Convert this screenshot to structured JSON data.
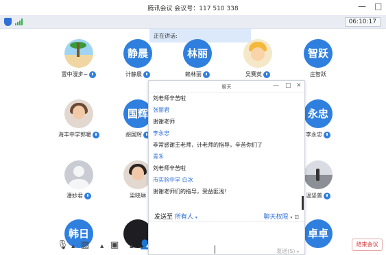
{
  "window": {
    "title": "腾讯会议 会议号：117 510 338",
    "minimize_glyph": "—",
    "maximize_glyph": "□"
  },
  "toolbar": {
    "elapsed": "06:10:17",
    "signal_color": "#38b048",
    "shield_color": "#2f6fd6"
  },
  "speaking": {
    "label": "正在讲话:"
  },
  "participants": {
    "row1": [
      {
        "name": "雲中漫步~",
        "avatar": "beach",
        "mic": true
      },
      {
        "name": "计静晨",
        "avatar_text": "静晨",
        "mic": true
      },
      {
        "name": "赖林丽",
        "avatar_text": "林丽",
        "mic": true
      },
      {
        "name": "吴赛英",
        "avatar": "cartoon",
        "mic": true
      },
      {
        "name": "庄智跃",
        "avatar_text": "智跃",
        "mic": false
      }
    ],
    "row2": [
      {
        "name": "海丰中学郭暖",
        "avatar": "photo",
        "mic": true
      },
      {
        "name": "胡国辉",
        "avatar_text": "国辉",
        "mic": true
      },
      {
        "name": "李永忠",
        "avatar_text": "永忠",
        "mic": true
      }
    ],
    "row3": [
      {
        "name": "潘妙君",
        "avatar": "default",
        "mic": true
      },
      {
        "name": "梁晓琳",
        "avatar": "photo",
        "mic": false
      },
      {
        "name": "温坚普",
        "avatar": "road",
        "mic": true
      }
    ],
    "row4": [
      {
        "avatar_text": "韩日"
      },
      {
        "avatar": "dark"
      },
      {
        "avatar_text": "卓卓"
      }
    ]
  },
  "chat": {
    "title": "聊天",
    "messages": [
      {
        "text": "刘老师辛苦啦"
      },
      {
        "sender": "张丽君",
        "text": "谢谢老师"
      },
      {
        "sender": "李永忠",
        "text": "非常感谢王老师，计老师的指导，辛苦你们了"
      },
      {
        "sender": "青禾",
        "text": "刘老师辛苦啦"
      },
      {
        "sender": "市实验中学 白冰",
        "text": "谢谢老师们的指导，受益匪浅！"
      }
    ],
    "send_to_label": "发送至",
    "send_to_target": "所有人",
    "permission_label": "聊天权限",
    "send_button": "发送(S)"
  },
  "bottom_bar": {
    "end_meeting": "结束会议"
  },
  "colors": {
    "accent": "#2f7fdf",
    "end_red": "#d43a3a"
  }
}
